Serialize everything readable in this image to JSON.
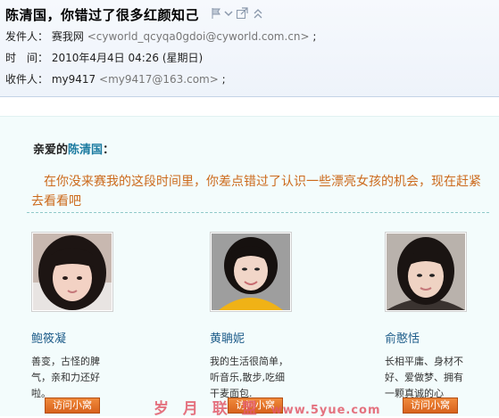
{
  "header": {
    "subject": "陈清国，你错过了很多红颜知己",
    "from_label": "发件人：",
    "from_name": "赛我网",
    "from_addr": "<cyworld_qcyqa0gdoi@cyworld.com.cn>",
    "from_sep": ";",
    "time_label": "时　间：",
    "time_value": "2010年4月4日 04:26 (星期日)",
    "to_label": "收件人：",
    "to_name": "my9417",
    "to_addr": "<my9417@163.com>",
    "to_sep": ";",
    "icons": [
      "flag-icon",
      "chevron-down-icon",
      "popout-icon",
      "collapse-icon"
    ]
  },
  "body": {
    "greeting_prefix": "亲爱的",
    "greeting_name": "陈清国",
    "greeting_suffix": "：",
    "intro": "在你没来赛我的这段时间里，你差点错过了认识一些漂亮女孩的机会，现在赶紧去看看吧"
  },
  "girls": [
    {
      "name": "鲍筱凝",
      "desc": "善变，古怪的脾气，亲和力还好啦。",
      "button": "访问小窝"
    },
    {
      "name": "黄聃妮",
      "desc": "我的生活很简单，听音乐,散步,吃细干麦面包.",
      "button": "访问小窝"
    },
    {
      "name": "俞憨恬",
      "desc": "长相平庸、身材不好、爱做梦、拥有一颗真诚的心",
      "button": "访问小窝"
    }
  ],
  "watermark": {
    "text": "岁 月 联 盟",
    "url": "www.5yue.com"
  },
  "colors": {
    "accent_link": "#1f5d8a",
    "intro_text": "#cc6a1c",
    "card_bg": "#f3fcfc",
    "button": "#e0712a",
    "watermark": "#e25a6a"
  }
}
